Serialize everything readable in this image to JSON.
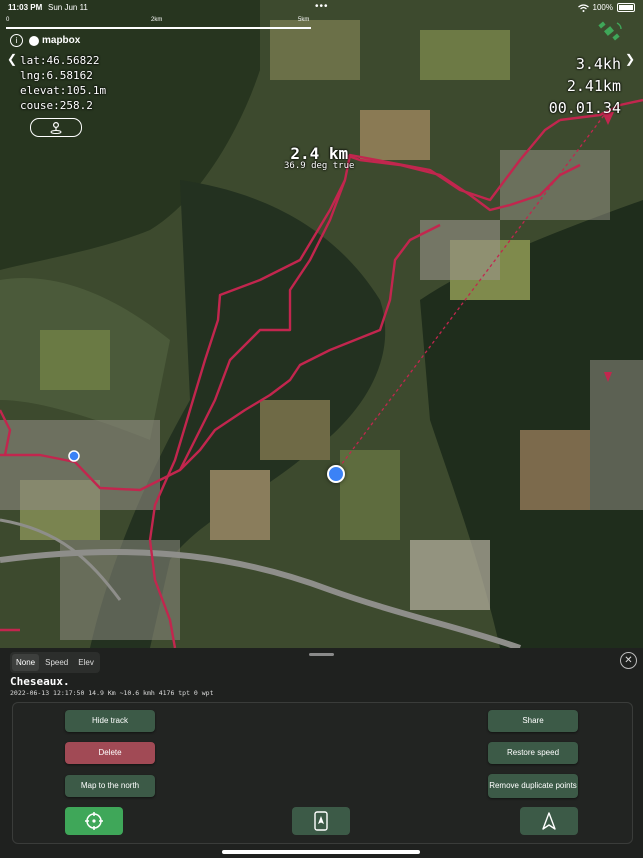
{
  "status_bar": {
    "time": "11:03 PM",
    "date": "Sun Jun 11",
    "battery": "100%"
  },
  "scale": {
    "labels": [
      "0",
      "",
      "2km",
      "5km"
    ]
  },
  "attribution": {
    "info": "i",
    "logo": "mapbox"
  },
  "coords": {
    "lat": "lat:46.56822",
    "lng": "lng:6.58162",
    "elev": "elevat:105.1m",
    "course": "couse:258.2"
  },
  "stats": {
    "speed": "3.4kh",
    "distance": "2.41km",
    "time": "00.01.34"
  },
  "measure": {
    "distance": "2.4 km",
    "bearing": "36.9 deg true"
  },
  "sheet": {
    "tabs": [
      "None",
      "Speed",
      "Elev"
    ],
    "active_tab": "None",
    "place": "Cheseaux.",
    "track_info": "2022-06-13 12:17:50 14.9 Km ~10.6 kmh 4176 tpt 0 wpt",
    "buttons": {
      "hide_track": "Hide track",
      "delete": "Delete",
      "map_north": "Map to the north",
      "share": "Share",
      "restore_speed": "Restore speed",
      "remove_duplicates": "Remove duplicate points"
    }
  },
  "icons": {
    "info": "info-icon",
    "sat": "satellite-icon",
    "pin": "pin-icon",
    "locate": "crosshair-icon",
    "phone": "phone-navigation-icon",
    "north": "north-arrow-icon"
  },
  "colors": {
    "track": "#c2264e",
    "button": "#3c5a47",
    "danger": "#a14a55",
    "primary": "#3fa759",
    "location": "#3b82f6"
  }
}
